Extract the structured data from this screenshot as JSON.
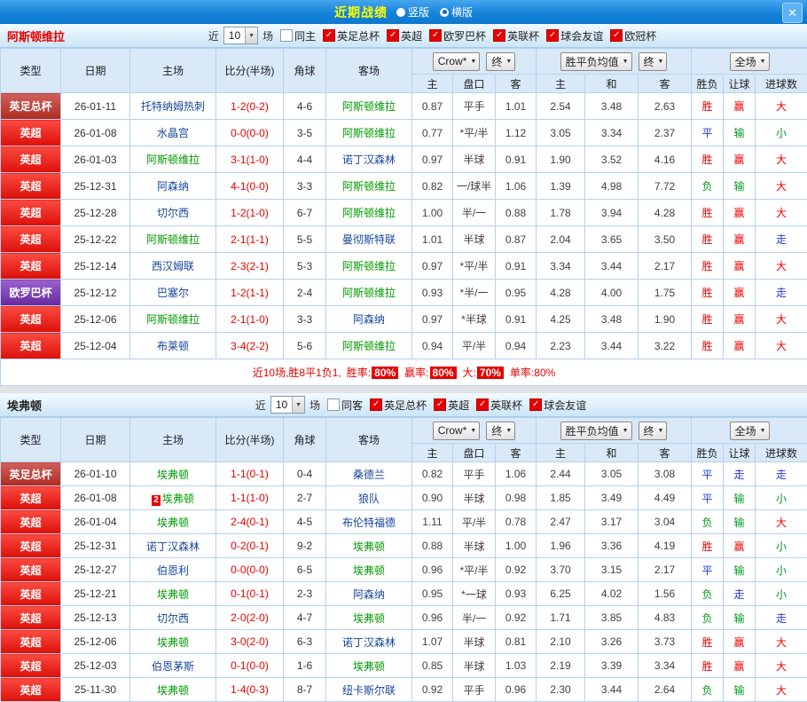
{
  "titlebar": {
    "title": "近期战绩",
    "radios": [
      {
        "label": "竖版",
        "checked": false
      },
      {
        "label": "横版",
        "checked": true
      }
    ],
    "close": "✕"
  },
  "colors": {
    "titlebar_blue": "#1583da",
    "title_yellow": "#ffff00",
    "win_red": "#f00000",
    "lose_green": "#009922",
    "draw_blue": "#2439d8",
    "score_red": "#e60000",
    "focus_team_green": "#009900",
    "other_team_navy": "#16459c",
    "league_epl": "#dd0f08",
    "league_facup": "#ae2b22",
    "league_uel": "#67299e",
    "checkbox_red": "#e60000"
  },
  "table_header": {
    "type": "类型",
    "date": "日期",
    "home": "主场",
    "score": "比分(半场)",
    "corner": "角球",
    "away": "客场",
    "dd_bookmaker": "Crow*",
    "dd_final_1": "终",
    "dd_wdl_avg": "胜平负均值",
    "dd_final_2": "终",
    "dd_scope": "全场",
    "sub": {
      "ah_home": "主",
      "handicap": "盘口",
      "ah_away": "客",
      "win": "主",
      "draw": "和",
      "lose": "客",
      "result": "胜负",
      "handicap_result": "让球",
      "goals": "进球数"
    }
  },
  "sections": [
    {
      "team": "阿斯顿维拉",
      "team_color": "#e60000",
      "filter": {
        "near_label": "近",
        "games_value": "10",
        "games_label": "场",
        "checkboxes": [
          {
            "label": "同主",
            "checked": false
          },
          {
            "label": "英足总杯",
            "checked": true
          },
          {
            "label": "英超",
            "checked": true
          },
          {
            "label": "欧罗巴杯",
            "checked": true
          },
          {
            "label": "英联杯",
            "checked": true
          },
          {
            "label": "球会友谊",
            "checked": true
          },
          {
            "label": "欧冠杯",
            "checked": true
          }
        ]
      },
      "rows": [
        {
          "league": "英足总杯",
          "league_key": "facup",
          "date": "26-01-11",
          "home": "托特纳姆热刺",
          "home_focus": false,
          "score": "1-2(0-2)",
          "corner": "4-6",
          "away": "阿斯顿维拉",
          "away_focus": true,
          "ah_home": "0.87",
          "handicap": "平手",
          "ah_away": "1.01",
          "win": "2.54",
          "draw": "3.48",
          "lose": "2.63",
          "result": "胜",
          "handicap_result": "赢",
          "goals": "大"
        },
        {
          "league": "英超",
          "league_key": "epl",
          "date": "26-01-08",
          "home": "水晶宫",
          "home_focus": false,
          "score": "0-0(0-0)",
          "corner": "3-5",
          "away": "阿斯顿维拉",
          "away_focus": true,
          "ah_home": "0.77",
          "handicap": "*平/半",
          "ah_away": "1.12",
          "win": "3.05",
          "draw": "3.34",
          "lose": "2.37",
          "result": "平",
          "handicap_result": "输",
          "goals": "小"
        },
        {
          "league": "英超",
          "league_key": "epl",
          "date": "26-01-03",
          "home": "阿斯顿维拉",
          "home_focus": true,
          "score": "3-1(1-0)",
          "corner": "4-4",
          "away": "诺丁汉森林",
          "away_focus": false,
          "ah_home": "0.97",
          "handicap": "半球",
          "ah_away": "0.91",
          "win": "1.90",
          "draw": "3.52",
          "lose": "4.16",
          "result": "胜",
          "handicap_result": "赢",
          "goals": "大"
        },
        {
          "league": "英超",
          "league_key": "epl",
          "date": "25-12-31",
          "home": "阿森纳",
          "home_focus": false,
          "score": "4-1(0-0)",
          "corner": "3-3",
          "away": "阿斯顿维拉",
          "away_focus": true,
          "ah_home": "0.82",
          "handicap": "一/球半",
          "ah_away": "1.06",
          "win": "1.39",
          "draw": "4.98",
          "lose": "7.72",
          "result": "负",
          "handicap_result": "输",
          "goals": "大"
        },
        {
          "league": "英超",
          "league_key": "epl",
          "date": "25-12-28",
          "home": "切尔西",
          "home_focus": false,
          "score": "1-2(1-0)",
          "corner": "6-7",
          "away": "阿斯顿维拉",
          "away_focus": true,
          "ah_home": "1.00",
          "handicap": "半/一",
          "ah_away": "0.88",
          "win": "1.78",
          "draw": "3.94",
          "lose": "4.28",
          "result": "胜",
          "handicap_result": "赢",
          "goals": "大"
        },
        {
          "league": "英超",
          "league_key": "epl",
          "date": "25-12-22",
          "home": "阿斯顿维拉",
          "home_focus": true,
          "score": "2-1(1-1)",
          "corner": "5-5",
          "away": "曼彻斯特联",
          "away_focus": false,
          "ah_home": "1.01",
          "handicap": "半球",
          "ah_away": "0.87",
          "win": "2.04",
          "draw": "3.65",
          "lose": "3.50",
          "result": "胜",
          "handicap_result": "赢",
          "goals": "走"
        },
        {
          "league": "英超",
          "league_key": "epl",
          "date": "25-12-14",
          "home": "西汉姆联",
          "home_focus": false,
          "score": "2-3(2-1)",
          "corner": "5-3",
          "away": "阿斯顿维拉",
          "away_focus": true,
          "ah_home": "0.97",
          "handicap": "*平/半",
          "ah_away": "0.91",
          "win": "3.34",
          "draw": "3.44",
          "lose": "2.17",
          "result": "胜",
          "handicap_result": "赢",
          "goals": "大"
        },
        {
          "league": "欧罗巴杯",
          "league_key": "uel",
          "date": "25-12-12",
          "home": "巴塞尔",
          "home_focus": false,
          "score": "1-2(1-1)",
          "corner": "2-4",
          "away": "阿斯顿维拉",
          "away_focus": true,
          "ah_home": "0.93",
          "handicap": "*半/一",
          "ah_away": "0.95",
          "win": "4.28",
          "draw": "4.00",
          "lose": "1.75",
          "result": "胜",
          "handicap_result": "赢",
          "goals": "走"
        },
        {
          "league": "英超",
          "league_key": "epl",
          "date": "25-12-06",
          "home": "阿斯顿维拉",
          "home_focus": true,
          "score": "2-1(1-0)",
          "corner": "3-3",
          "away": "阿森纳",
          "away_focus": false,
          "ah_home": "0.97",
          "handicap": "*半球",
          "ah_away": "0.91",
          "win": "4.25",
          "draw": "3.48",
          "lose": "1.90",
          "result": "胜",
          "handicap_result": "赢",
          "goals": "大"
        },
        {
          "league": "英超",
          "league_key": "epl",
          "date": "25-12-04",
          "home": "布莱顿",
          "home_focus": false,
          "score": "3-4(2-2)",
          "corner": "5-6",
          "away": "阿斯顿维拉",
          "away_focus": true,
          "ah_home": "0.94",
          "handicap": "平/半",
          "ah_away": "0.94",
          "win": "2.23",
          "draw": "3.44",
          "lose": "3.22",
          "result": "胜",
          "handicap_result": "赢",
          "goals": "大"
        }
      ],
      "summary": {
        "text": "近10场,胜8平1负1,",
        "items": [
          {
            "label": "胜率:",
            "value": "80%",
            "chip": true
          },
          {
            "label": "赢率:",
            "value": "80%",
            "chip": true
          },
          {
            "label": "大:",
            "value": "70%",
            "chip": true
          },
          {
            "label": "单率:",
            "value": "80%",
            "chip": false
          }
        ]
      }
    },
    {
      "team": "埃弗顿",
      "team_color": "#222222",
      "filter": {
        "near_label": "近",
        "games_value": "10",
        "games_label": "场",
        "checkboxes": [
          {
            "label": "同客",
            "checked": false
          },
          {
            "label": "英足总杯",
            "checked": true
          },
          {
            "label": "英超",
            "checked": true
          },
          {
            "label": "英联杯",
            "checked": true
          },
          {
            "label": "球会友谊",
            "checked": true
          }
        ]
      },
      "rows": [
        {
          "league": "英足总杯",
          "league_key": "facup",
          "date": "26-01-10",
          "home": "埃弗顿",
          "home_focus": true,
          "score": "1-1(0-1)",
          "corner": "0-4",
          "away": "桑德兰",
          "away_focus": false,
          "ah_home": "0.82",
          "handicap": "平手",
          "ah_away": "1.06",
          "win": "2.44",
          "draw": "3.05",
          "lose": "3.08",
          "result": "平",
          "handicap_result": "走",
          "goals": "走"
        },
        {
          "league": "英超",
          "league_key": "epl",
          "date": "26-01-08",
          "home": "埃弗顿",
          "home_focus": true,
          "home_badge": "2",
          "score": "1-1(1-0)",
          "corner": "2-7",
          "away": "狼队",
          "away_focus": false,
          "ah_home": "0.90",
          "handicap": "半球",
          "ah_away": "0.98",
          "win": "1.85",
          "draw": "3.49",
          "lose": "4.49",
          "result": "平",
          "handicap_result": "输",
          "goals": "小"
        },
        {
          "league": "英超",
          "league_key": "epl",
          "date": "26-01-04",
          "home": "埃弗顿",
          "home_focus": true,
          "score": "2-4(0-1)",
          "corner": "4-5",
          "away": "布伦特福德",
          "away_focus": false,
          "ah_home": "1.11",
          "handicap": "平/半",
          "ah_away": "0.78",
          "win": "2.47",
          "draw": "3.17",
          "lose": "3.04",
          "result": "负",
          "handicap_result": "输",
          "goals": "大"
        },
        {
          "league": "英超",
          "league_key": "epl",
          "date": "25-12-31",
          "home": "诺丁汉森林",
          "home_focus": false,
          "score": "0-2(0-1)",
          "corner": "9-2",
          "away": "埃弗顿",
          "away_focus": true,
          "ah_home": "0.88",
          "handicap": "半球",
          "ah_away": "1.00",
          "win": "1.96",
          "draw": "3.36",
          "lose": "4.19",
          "result": "胜",
          "handicap_result": "赢",
          "goals": "小"
        },
        {
          "league": "英超",
          "league_key": "epl",
          "date": "25-12-27",
          "home": "伯恩利",
          "home_focus": false,
          "score": "0-0(0-0)",
          "corner": "6-5",
          "away": "埃弗顿",
          "away_focus": true,
          "ah_home": "0.96",
          "handicap": "*平/半",
          "ah_away": "0.92",
          "win": "3.70",
          "draw": "3.15",
          "lose": "2.17",
          "result": "平",
          "handicap_result": "输",
          "goals": "小"
        },
        {
          "league": "英超",
          "league_key": "epl",
          "date": "25-12-21",
          "home": "埃弗顿",
          "home_focus": true,
          "score": "0-1(0-1)",
          "corner": "2-3",
          "away": "阿森纳",
          "away_focus": false,
          "ah_home": "0.95",
          "handicap": "*一球",
          "ah_away": "0.93",
          "win": "6.25",
          "draw": "4.02",
          "lose": "1.56",
          "result": "负",
          "handicap_result": "走",
          "goals": "小"
        },
        {
          "league": "英超",
          "league_key": "epl",
          "date": "25-12-13",
          "home": "切尔西",
          "home_focus": false,
          "score": "2-0(2-0)",
          "corner": "4-7",
          "away": "埃弗顿",
          "away_focus": true,
          "ah_home": "0.96",
          "handicap": "半/一",
          "ah_away": "0.92",
          "win": "1.71",
          "draw": "3.85",
          "lose": "4.83",
          "result": "负",
          "handicap_result": "输",
          "goals": "走"
        },
        {
          "league": "英超",
          "league_key": "epl",
          "date": "25-12-06",
          "home": "埃弗顿",
          "home_focus": true,
          "score": "3-0(2-0)",
          "corner": "6-3",
          "away": "诺丁汉森林",
          "away_focus": false,
          "ah_home": "1.07",
          "handicap": "半球",
          "ah_away": "0.81",
          "win": "2.10",
          "draw": "3.26",
          "lose": "3.73",
          "result": "胜",
          "handicap_result": "赢",
          "goals": "大"
        },
        {
          "league": "英超",
          "league_key": "epl",
          "date": "25-12-03",
          "home": "伯恩茅斯",
          "home_focus": false,
          "score": "0-1(0-0)",
          "corner": "1-6",
          "away": "埃弗顿",
          "away_focus": true,
          "ah_home": "0.85",
          "handicap": "半球",
          "ah_away": "1.03",
          "win": "2.19",
          "draw": "3.39",
          "lose": "3.34",
          "result": "胜",
          "handicap_result": "赢",
          "goals": "大"
        },
        {
          "league": "英超",
          "league_key": "epl",
          "date": "25-11-30",
          "home": "埃弗顿",
          "home_focus": true,
          "score": "1-4(0-3)",
          "corner": "8-7",
          "away": "纽卡斯尔联",
          "away_focus": false,
          "ah_home": "0.92",
          "handicap": "平手",
          "ah_away": "0.96",
          "win": "2.30",
          "draw": "3.44",
          "lose": "2.64",
          "result": "负",
          "handicap_result": "输",
          "goals": "大"
        }
      ],
      "summary": null
    }
  ]
}
